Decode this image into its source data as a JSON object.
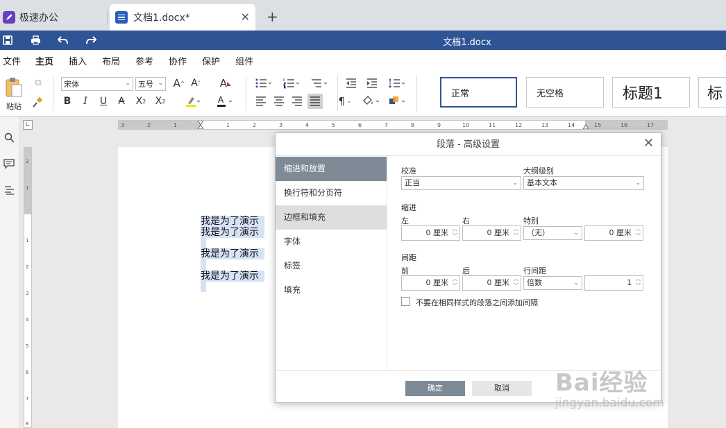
{
  "tabs": [
    {
      "label": "极速办公"
    },
    {
      "label": "文档1.docx*"
    }
  ],
  "titlebar": {
    "title": "文档1.docx"
  },
  "menu": [
    "文件",
    "主页",
    "插入",
    "布局",
    "参考",
    "协作",
    "保护",
    "组件"
  ],
  "menu_active": "主页",
  "ribbon": {
    "paste_label": "粘贴",
    "font_name": "宋体",
    "font_size": "五号",
    "styles": [
      "正常",
      "无空格",
      "标题1",
      "标"
    ]
  },
  "document": {
    "lines": [
      "我是为了演示",
      "我是为了演示",
      "我是为了演示",
      "我是为了演示"
    ]
  },
  "dialog": {
    "title": "段落 - 高级设置",
    "nav": [
      "缩进和放置",
      "换行符和分页符",
      "边框和填充",
      "字体",
      "标签",
      "填充"
    ],
    "alignment_label": "校准",
    "alignment_value": "正当",
    "outline_label": "大纲级别",
    "outline_value": "基本文本",
    "indent_group": "缩进",
    "left_label": "左",
    "left_value": "0 厘米",
    "right_label": "右",
    "right_value": "0 厘米",
    "special_label": "特别",
    "special_value": "（无）",
    "special_amount": "0 厘米",
    "spacing_group": "间距",
    "before_label": "前",
    "before_value": "0 厘米",
    "after_label": "后",
    "after_value": "0 厘米",
    "line_spacing_label": "行间距",
    "line_spacing_value": "倍数",
    "line_spacing_amount": "1",
    "checkbox_label": "不要在相同样式的段落之间添加间隔",
    "ok_label": "确定",
    "cancel_label": "取消"
  },
  "watermark": {
    "brand": "Bai经验",
    "url": "jingyan.baidu.com"
  },
  "colors": {
    "accent": "#2f5496",
    "nav_active": "#7e8b96",
    "selection": "#d6e2f5"
  }
}
